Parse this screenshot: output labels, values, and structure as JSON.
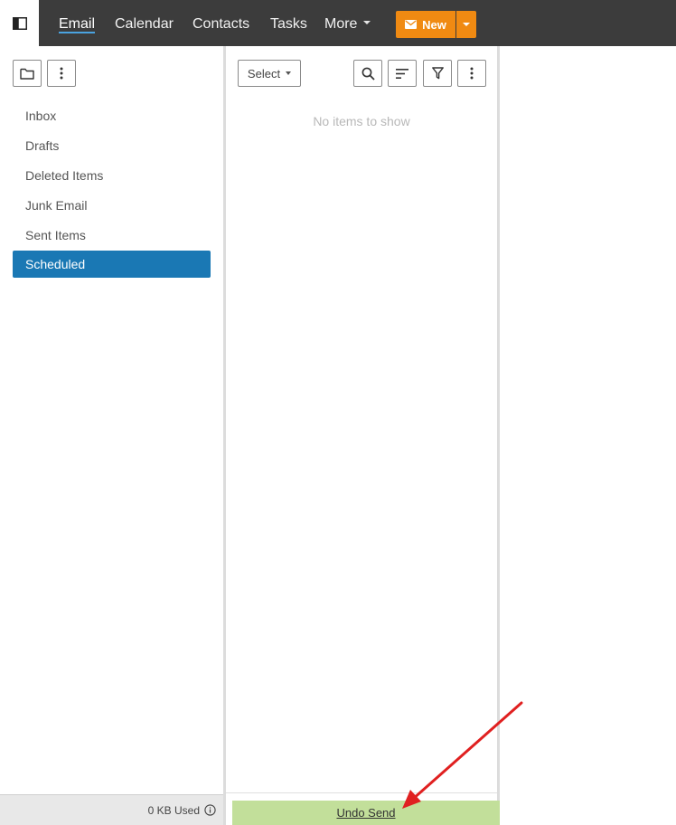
{
  "topbar": {
    "nav": [
      {
        "label": "Email",
        "active": true
      },
      {
        "label": "Calendar",
        "active": false
      },
      {
        "label": "Contacts",
        "active": false
      },
      {
        "label": "Tasks",
        "active": false
      },
      {
        "label": "More",
        "active": false
      }
    ],
    "new_button": {
      "label": "New",
      "icon": "envelope-icon"
    },
    "colors": {
      "bar": "#3c3c3c",
      "accent": "#f08a12",
      "active_underline": "#4aa3e0"
    }
  },
  "folders": {
    "toolbar_icons": [
      "folder-icon",
      "more-vertical-icon"
    ],
    "items": [
      {
        "label": "Inbox",
        "selected": false
      },
      {
        "label": "Drafts",
        "selected": false
      },
      {
        "label": "Deleted Items",
        "selected": false
      },
      {
        "label": "Junk Email",
        "selected": false
      },
      {
        "label": "Sent Items",
        "selected": false
      },
      {
        "label": "Scheduled",
        "selected": true
      }
    ],
    "selected_color": "#1a78b4",
    "usage": "0 KB Used"
  },
  "list": {
    "select_label": "Select",
    "toolbar_icons": [
      "search-icon",
      "sort-icon",
      "filter-icon",
      "more-vertical-icon"
    ],
    "empty_message": "No items to show"
  },
  "undo": {
    "label": "Undo Send",
    "bar_color": "#c2df9a"
  },
  "annotation": {
    "arrow_color": "#e02020"
  }
}
